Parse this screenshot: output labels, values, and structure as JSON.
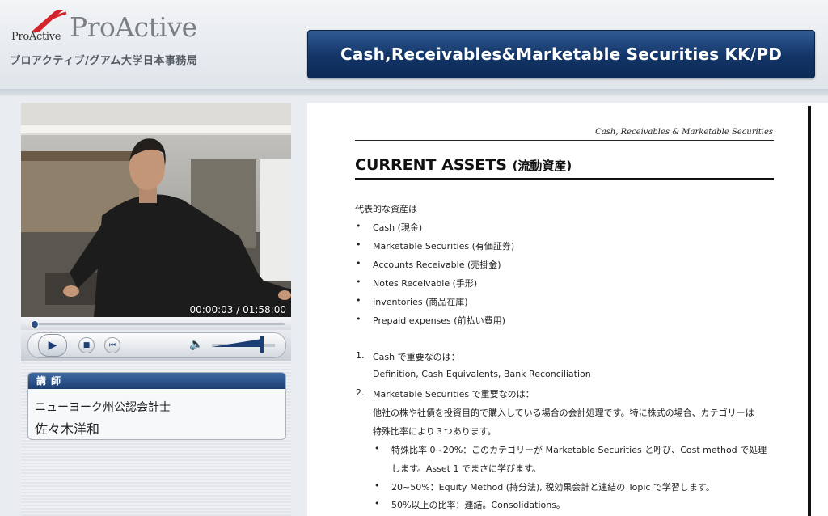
{
  "header": {
    "logo_mark_text": "ProActive",
    "brand_name": "ProActive",
    "brand_sub": "プロアクティブ/グアム大学日本事務局",
    "course_title": "Cash,Receivables&Marketable Securities KK/PD"
  },
  "player": {
    "timecode": "00:00:03 / 01:58:00",
    "progress_fraction": 0.0004,
    "volume_fraction": 0.8,
    "icons": [
      "play-icon",
      "stop-icon",
      "rewind-icon",
      "volume-icon"
    ]
  },
  "instructor": {
    "header": "講師",
    "title": "ニューヨーク州公認会計士",
    "name": "佐々木洋和"
  },
  "document": {
    "running_head": "Cash, Receivables & Marketable Securities",
    "heading": "CURRENT ASSETS",
    "heading_jp": "(流動資産)",
    "intro": "代表的な資産は",
    "assets": [
      "Cash (現金)",
      "Marketable Securities (有価証券)",
      "Accounts Receivable (売掛金)",
      "Notes Receivable (手形)",
      "Inventories (商品在庫)",
      "Prepaid expenses (前払い費用)"
    ],
    "item1_num": "1.",
    "item1_title": "Cash で重要なのは：",
    "item1_detail": "Definition, Cash Equivalents, Bank Reconciliation",
    "item2_num": "2.",
    "item2_title": "Marketable Securities で重要なのは：",
    "item2_line1": "他社の株や社債を投資目的で購入している場合の会計処理です。特に株式の場合、カテゴリーは",
    "item2_line2": "特殊比率により３つあります。",
    "sub_a_line1": "特殊比率 0~20%：このカテゴリーが Marketable Securities と呼び、Cost method で処理",
    "sub_a_line2": "します。Asset 1 でまさに学びます。",
    "sub_b": "20~50%：Equity Method (持分法), 税効果会計と連結の Topic で学習します。",
    "sub_c": "50%以上の比率：連結。Consolidations。"
  }
}
